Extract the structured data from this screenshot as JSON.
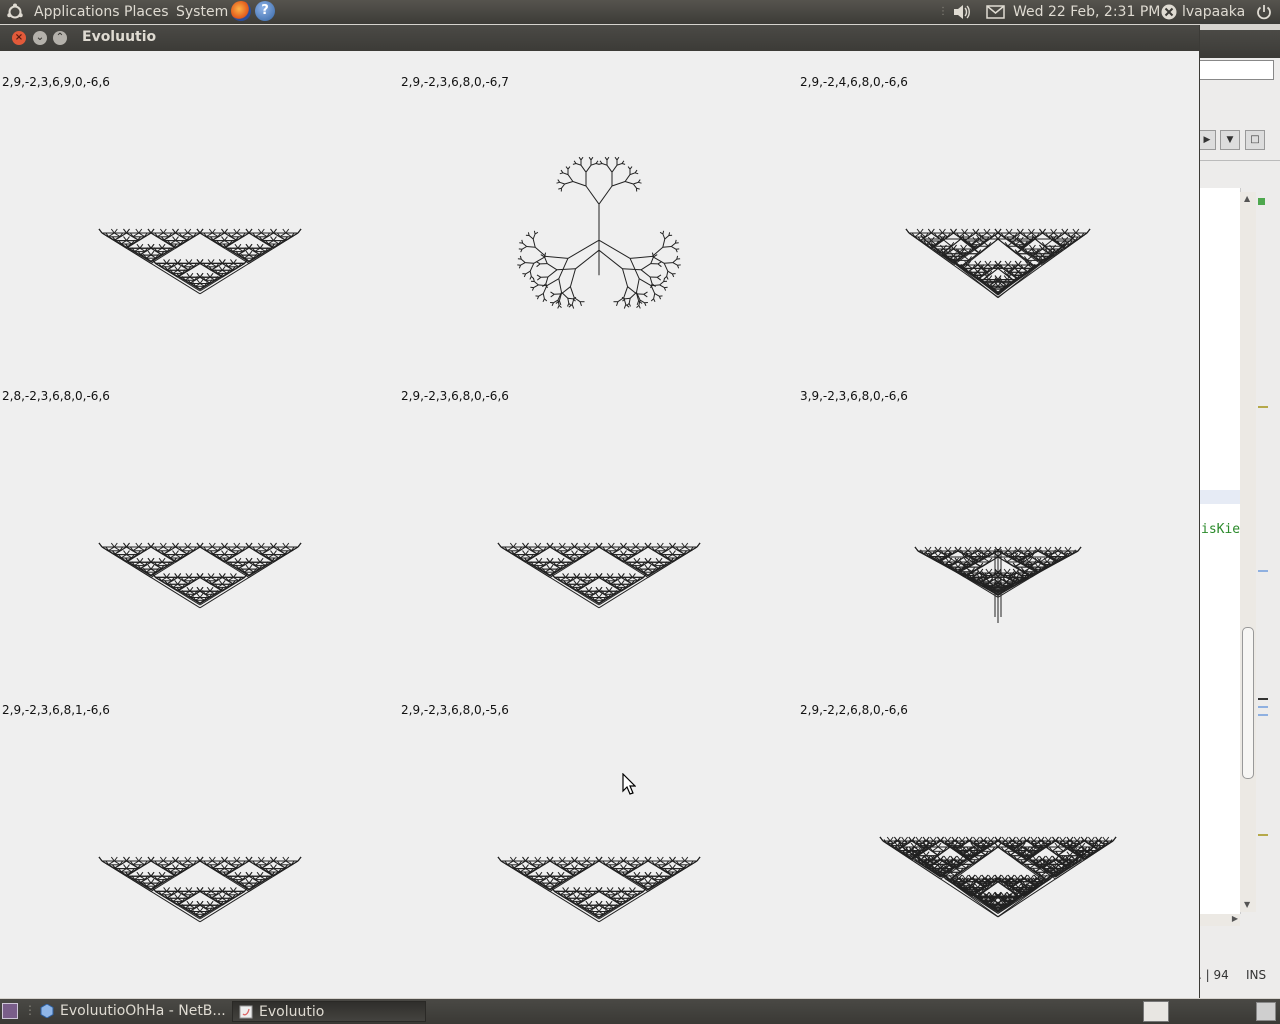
{
  "top_panel": {
    "menus": [
      "Applications",
      "Places",
      "System"
    ],
    "clock": "Wed 22 Feb,  2:31 PM",
    "user": "lvapaaka",
    "icons": [
      "ubuntu-logo-icon",
      "firefox-icon",
      "help-icon",
      "volume-icon",
      "mail-icon",
      "user-status-icon",
      "power-icon"
    ]
  },
  "window": {
    "title": "Evoluutio",
    "buttons": [
      "close",
      "minimize",
      "maximize"
    ]
  },
  "grid": {
    "cells": [
      {
        "label": "2,9,-2,3,6,9,0,-6,6",
        "shape": "dense"
      },
      {
        "label": "2,9,-2,3,6,8,0,-6,7",
        "shape": "tree"
      },
      {
        "label": "2,9,-2,4,6,8,0,-6,6",
        "shape": "mesh"
      },
      {
        "label": "2,8,-2,3,6,8,0,-6,6",
        "shape": "dense"
      },
      {
        "label": "2,9,-2,3,6,8,0,-6,6",
        "shape": "dense"
      },
      {
        "label": "3,9,-2,3,6,8,0,-6,6",
        "shape": "column"
      },
      {
        "label": "2,9,-2,3,6,8,1,-6,6",
        "shape": "dense"
      },
      {
        "label": "2,9,-2,3,6,8,0,-5,6",
        "shape": "dense"
      },
      {
        "label": "2,9,-2,2,6,8,0,-6,6",
        "shape": "large"
      }
    ]
  },
  "background_window": {
    "fragment_text": "isKie",
    "status_line": ". | 94",
    "status_mode": "INS"
  },
  "taskbar": {
    "tasks": [
      {
        "label": "EvoluutioOhHa - NetB...",
        "icon": "netbeans-icon",
        "active": false
      },
      {
        "label": "Evoluutio",
        "icon": "java-app-icon",
        "active": true
      }
    ]
  },
  "colors": {
    "panel": "#3c3b37",
    "window_bg": "#efefef",
    "close_button": "#e25a3a",
    "drawing": "#222222"
  }
}
